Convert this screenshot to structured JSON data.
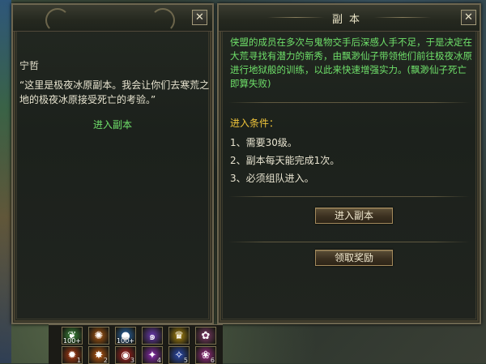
{
  "npc_dialog": {
    "close_label": "✕",
    "npc_name": "宁哲",
    "speech": "“这里是极夜冰原副本。我会让你们去寒荒之地的极夜冰原接受死亡的考验。”",
    "enter_link": "进入副本"
  },
  "dungeon_panel": {
    "title": "副本",
    "close_label": "✕",
    "description": "侠盟的成员在多次与鬼物交手后深感人手不足，于是决定在大荒寻找有潜力的新秀，由飘渺仙子带领他们前往极夜冰原进行地狱般的训练，以此来快速增强实力。(飘渺仙子死亡即算失败)",
    "conditions_title": "进入条件：",
    "conditions": [
      "1、需要30级。",
      "2、副本每天能完成1次。",
      "3、必须组队进入。"
    ],
    "enter_button": "进入副本",
    "reward_button": "领取奖励"
  },
  "skillbar": {
    "row1": [
      {
        "icon": "leaf-icon",
        "count": "100+",
        "color": "#3a8a3a"
      },
      {
        "icon": "fire-swirl-icon",
        "count": "",
        "color": "#b05a10"
      },
      {
        "icon": "blue-orb-icon",
        "count": "100+",
        "color": "#2a6ab0"
      },
      {
        "icon": "purple-spiral-icon",
        "count": "",
        "color": "#6a3ab0"
      },
      {
        "icon": "crown-icon",
        "count": "",
        "color": "#b08a10"
      },
      {
        "icon": "swirl-icon",
        "count": "",
        "color": "#803a6a"
      }
    ],
    "row2": [
      {
        "icon": "flame-icon",
        "num": "1",
        "color": "#b03a10"
      },
      {
        "icon": "fire-orb-icon",
        "num": "2",
        "color": "#c05a10"
      },
      {
        "icon": "red-orb-icon",
        "num": "3",
        "color": "#b02020"
      },
      {
        "icon": "purple-flame-icon",
        "num": "4",
        "color": "#8a2ab0"
      },
      {
        "icon": "blue-flame-icon",
        "num": "5",
        "color": "#2a4ab0"
      },
      {
        "icon": "magenta-icon",
        "num": "6",
        "color": "#a02a8a"
      }
    ]
  }
}
